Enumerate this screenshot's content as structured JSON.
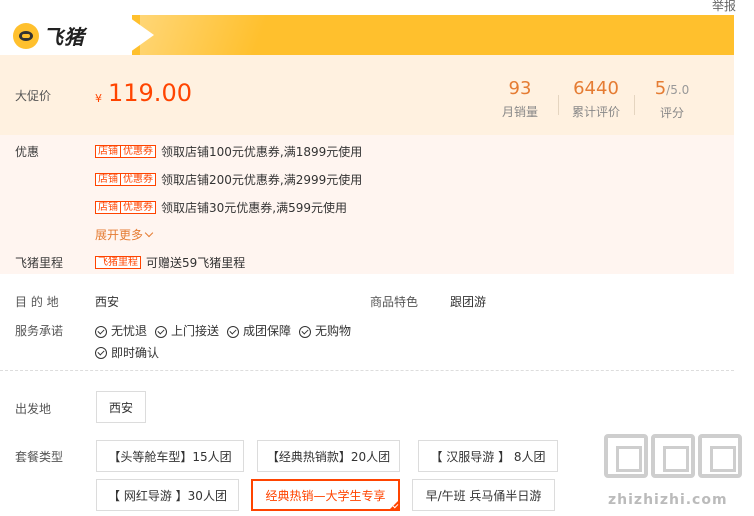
{
  "header": {
    "report_link": "举报",
    "logo_text": "飞猪"
  },
  "price": {
    "label": "大促价",
    "currency": "¥",
    "value": "119.00",
    "stats": [
      {
        "value": "93",
        "sub": "",
        "label": "月销量"
      },
      {
        "value": "6440",
        "sub": "",
        "label": "累计评价"
      },
      {
        "value": "5",
        "sub": "/5.0",
        "label": "评分"
      }
    ]
  },
  "promotions": {
    "label": "优惠",
    "coupons": [
      {
        "tag_a": "店铺",
        "tag_b": "优惠券",
        "text": "领取店铺100元优惠券,满1899元使用"
      },
      {
        "tag_a": "店铺",
        "tag_b": "优惠券",
        "text": "领取店铺200元优惠券,满2999元使用"
      },
      {
        "tag_a": "店铺",
        "tag_b": "优惠券",
        "text": "领取店铺30元优惠券,满599元使用"
      }
    ],
    "expand_more": "展开更多",
    "mileage_label": "飞猪里程",
    "mileage_tag": "飞猪里程",
    "mileage_text": "可赠送59飞猪里程"
  },
  "info": {
    "destination_label": "目 的 地",
    "destination_value": "西安",
    "feature_label": "商品特色",
    "feature_value": "跟团游",
    "promise_label": "服务承诺",
    "promises": [
      "无忧退",
      "上门接送",
      "成团保障",
      "无购物",
      "即时确认"
    ]
  },
  "departure": {
    "label": "出发地",
    "option": "西安"
  },
  "package": {
    "label": "套餐类型",
    "options": [
      "【头等舱车型】15人团",
      "【经典热销款】20人团",
      "【 汉服导游 】 8人团",
      "【 网红导游 】30人团",
      "经典热销—大学生专享",
      "早/午班 兵马俑半日游"
    ],
    "selected_index": 4
  },
  "watermark": {
    "text": "zhizhizhi.com"
  },
  "colors": {
    "accent": "#ff4400",
    "banner": "#ffc02d",
    "stat": "#e57c33"
  }
}
